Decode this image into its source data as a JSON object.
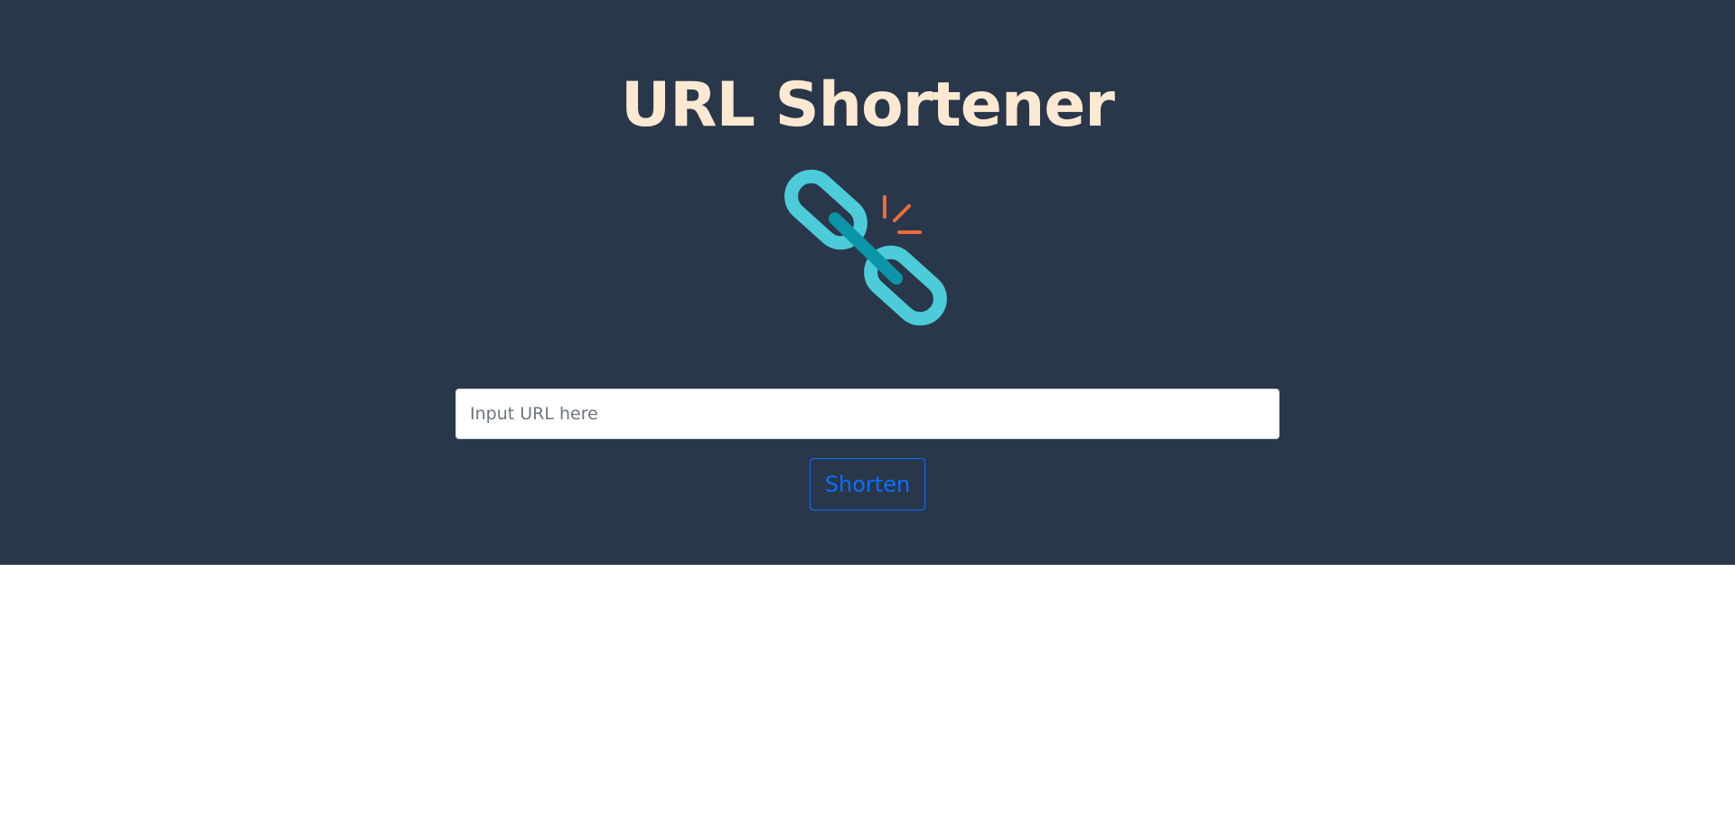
{
  "header": {
    "title": "URL Shortener",
    "logo_icon": "broken-chain-link-icon"
  },
  "form": {
    "url_placeholder": "Input URL here",
    "url_value": "",
    "shorten_label": "Shorten"
  },
  "colors": {
    "hero_background": "#29374b",
    "title_color": "#fde9d2",
    "chain_light": "#4ccbd8",
    "chain_dark": "#0a95a8",
    "spark": "#f26b3a",
    "button_accent": "#0d6efd"
  }
}
